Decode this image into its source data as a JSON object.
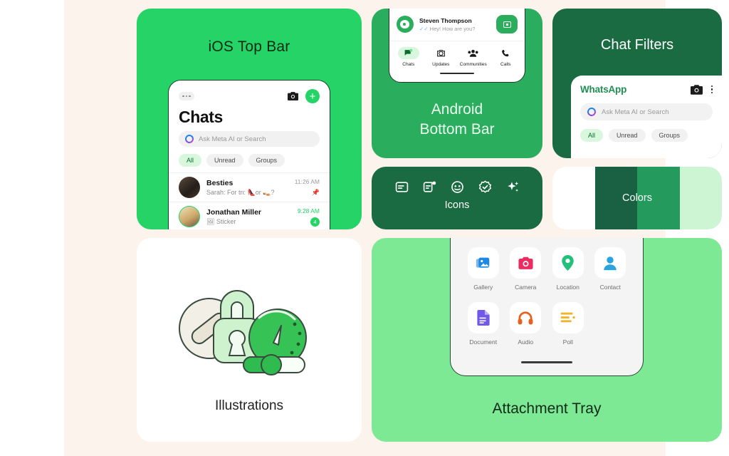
{
  "theme": {
    "page_bg": "#fbf3ec",
    "brand_green": "#25d366",
    "dark_green": "#1a6b41",
    "mid_green": "#2aae5d",
    "light_green": "#7ee995",
    "pale_green": "#d8f7dd"
  },
  "ios_card": {
    "title": "iOS Top Bar",
    "heading": "Chats",
    "search_placeholder": "Ask Meta AI or Search",
    "plus_label": "+",
    "filters": [
      {
        "label": "All",
        "active": true
      },
      {
        "label": "Unread",
        "active": false
      },
      {
        "label": "Groups",
        "active": false
      }
    ],
    "chats": [
      {
        "name": "Besties",
        "preview": "Sarah: For tn: 👠or 👡?",
        "time": "11:26 AM",
        "time_green": false,
        "pin": "📌",
        "badge": ""
      },
      {
        "name": "Jonathan Miller",
        "preview": "🖼 Sticker",
        "time": "9:28 AM",
        "time_green": true,
        "pin": "",
        "badge": "4"
      }
    ]
  },
  "android_card": {
    "caption_line1": "Android",
    "caption_line2": "Bottom Bar",
    "contact_name": "Steven Thompson",
    "contact_tick": "✓✓",
    "contact_message": "Hey! How are you?",
    "nav": [
      {
        "label": "Chats",
        "active": true
      },
      {
        "label": "Updates",
        "active": false
      },
      {
        "label": "Communities",
        "active": false
      },
      {
        "label": "Calls",
        "active": false
      }
    ]
  },
  "filters_card": {
    "title": "Chat Filters",
    "logo": "WhatsApp",
    "search_placeholder": "Ask Meta AI or Search",
    "filters": [
      {
        "label": "All",
        "active": true
      },
      {
        "label": "Unread",
        "active": false
      },
      {
        "label": "Groups",
        "active": false
      }
    ]
  },
  "icons_card": {
    "caption": "Icons",
    "icons": [
      "chat-bubble-icon",
      "chat-unread-icon",
      "channel-face-icon",
      "verified-check-icon",
      "meta-ai-sparkle-icon"
    ]
  },
  "colors_card": {
    "caption": "Colors",
    "swatches": [
      {
        "name": "white",
        "hex": "#ffffff"
      },
      {
        "name": "dark-green",
        "hex": "#1a6042"
      },
      {
        "name": "mid-green",
        "hex": "#249a5c"
      },
      {
        "name": "light-green",
        "hex": "#cdf5d4"
      }
    ]
  },
  "illustrations_card": {
    "caption": "Illustrations",
    "elements": [
      "block-sign",
      "padlock",
      "speedometer",
      "slider"
    ]
  },
  "attachment_card": {
    "caption": "Attachment Tray",
    "items": [
      {
        "label": "Gallery",
        "icon": "gallery-icon",
        "color": "#1e88e5"
      },
      {
        "label": "Camera",
        "icon": "camera-icon",
        "color": "#ec2b60"
      },
      {
        "label": "Location",
        "icon": "location-icon",
        "color": "#21c17a"
      },
      {
        "label": "Contact",
        "icon": "contact-icon",
        "color": "#2aa4e0"
      },
      {
        "label": "Document",
        "icon": "document-icon",
        "color": "#7258e8"
      },
      {
        "label": "Audio",
        "icon": "audio-icon",
        "color": "#e8601f"
      },
      {
        "label": "Poll",
        "icon": "poll-icon",
        "color": "#f0b429"
      }
    ]
  }
}
